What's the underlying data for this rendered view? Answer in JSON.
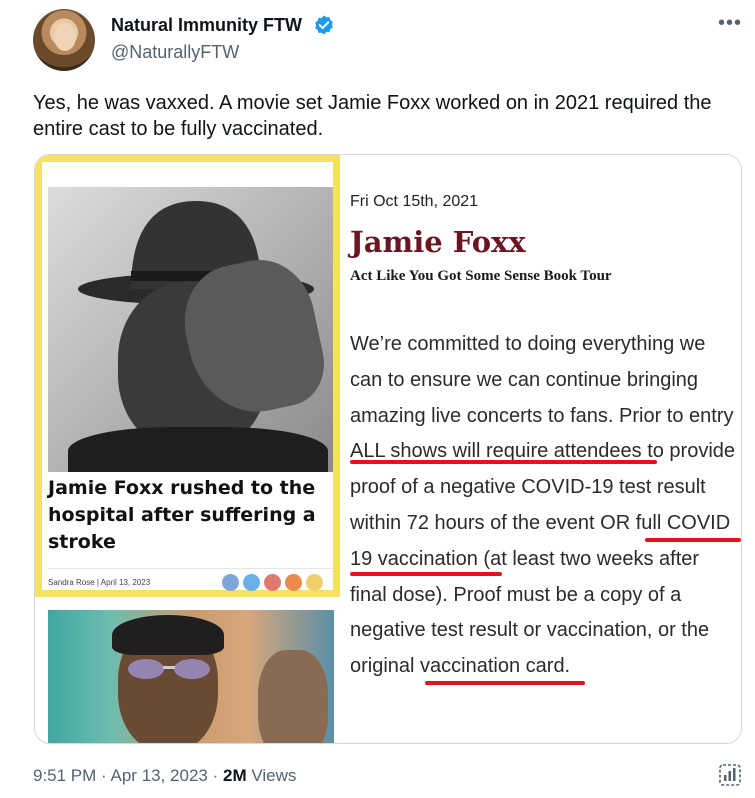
{
  "author": {
    "name": "Natural Immunity FTW",
    "handle": "@NaturallyFTW",
    "verified_color": "#1d9bf0"
  },
  "tweet": {
    "text": "Yes, he was vaxxed. A movie set Jamie Foxx worked on in 2021 required the entire cast to be fully vaccinated."
  },
  "media": {
    "article_left": {
      "headline": "Jamie Foxx rushed to the hospital after suffering a stroke",
      "byline": "Sandra Rose | April 13, 2023",
      "border_color": "#f7e163"
    },
    "article_right": {
      "date": "Fri Oct 15th, 2021",
      "title": "Jamie Foxx",
      "subtitle": "Act Like You Got Some Sense Book Tour",
      "body_lines": [
        "We’re committed to doing everything we",
        "can to ensure we can continue bringing",
        "amazing live concerts to fans. Prior to entry",
        "ALL shows will require attendees to provide",
        "proof of a negative COVID-19 test result",
        "within 72 hours of the event OR full COVID",
        "19 vaccination (at least two weeks after",
        "final dose). Proof must be a copy of a",
        "negative test result or vaccination, or the",
        "original vaccination card."
      ],
      "underline_color": "#e3121b"
    }
  },
  "footer": {
    "time": "9:51 PM",
    "separator": "·",
    "date": "Apr 13, 2023",
    "views_count": "2M",
    "views_label": "Views"
  }
}
